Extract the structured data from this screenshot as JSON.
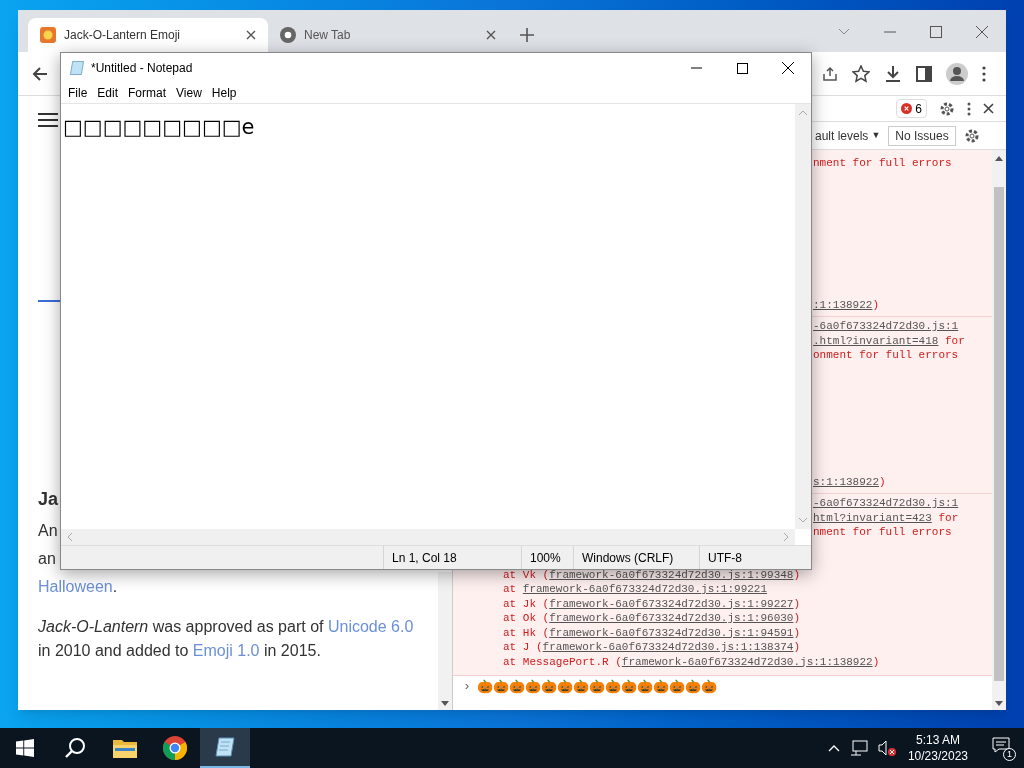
{
  "browser": {
    "tabs": [
      {
        "title": "Jack-O-Lantern Emoji",
        "selected": true
      },
      {
        "title": "New Tab",
        "selected": false
      }
    ],
    "page": {
      "heading": "Ja",
      "lines": [
        "An",
        "an"
      ],
      "link_line": {
        "link": "Halloween",
        "after": "."
      },
      "paragraph": [
        {
          "kind": "italic",
          "text": "Jack-O-Lantern"
        },
        {
          "kind": "plain",
          "text": " was approved as part of "
        },
        {
          "kind": "link",
          "text": "Unicode 6.0"
        },
        {
          "kind": "plain",
          "text": " in 2010 and added to "
        },
        {
          "kind": "link",
          "text": "Emoji 1.0"
        },
        {
          "kind": "plain",
          "text": " in 2015."
        }
      ]
    },
    "devtools": {
      "error_count": "6",
      "levels": "ault levels",
      "levels_caret": "▼",
      "issues": "No Issues",
      "messages": [
        {
          "top": [
            {
              "kind": "text",
              "text": "nment for full errors"
            }
          ],
          "bottom": [
            {
              "kind": "link",
              "text": ":1:138922"
            },
            {
              "kind": "text",
              "text": ")"
            }
          ]
        },
        {
          "top": [
            {
              "kind": "link",
              "text": "-6a0f673324d72d30.js:1"
            },
            {
              "kind": "link",
              "text": ".html?invariant=418",
              "after": " for"
            },
            {
              "kind": "text",
              "text": "onment for full errors"
            }
          ],
          "bottom": [
            {
              "kind": "link",
              "text": "s:1:138922"
            },
            {
              "kind": "text",
              "text": ")"
            }
          ]
        },
        {
          "top": [
            {
              "kind": "link",
              "text": "-6a0f673324d72d30.js:1"
            },
            {
              "kind": "link",
              "text": "html?invariant=423",
              "after": " for"
            },
            {
              "kind": "text",
              "text": "nment for full errors"
            }
          ],
          "stack": [
            {
              "prefix": "at Vk (",
              "src": "framework-6a0f673324d72d30.js:1:99348",
              "suffix": ")"
            },
            {
              "prefix": "at ",
              "src": "framework-6a0f673324d72d30.js:1:99221"
            },
            {
              "prefix": "at Jk (",
              "src": "framework-6a0f673324d72d30.js:1:99227",
              "suffix": ")"
            },
            {
              "prefix": "at Ok (",
              "src": "framework-6a0f673324d72d30.js:1:96030",
              "suffix": ")"
            },
            {
              "prefix": "at Hk (",
              "src": "framework-6a0f673324d72d30.js:1:94591",
              "suffix": ")"
            },
            {
              "prefix": "at J (",
              "src": "framework-6a0f673324d72d30.js:1:138374",
              "suffix": ")"
            },
            {
              "prefix": "at MessagePort.R (",
              "src": "framework-6a0f673324d72d30.js:1:138922",
              "suffix": ")"
            }
          ]
        }
      ],
      "prompt": "›",
      "input": "🎃🎃🎃🎃🎃🎃🎃🎃🎃🎃🎃🎃🎃🎃🎃"
    }
  },
  "notepad": {
    "title": "*Untitled - Notepad",
    "menu": [
      "File",
      "Edit",
      "Format",
      "View",
      "Help"
    ],
    "text": "□□□□□□□□□e",
    "status": [
      "Ln 1, Col 18",
      "100%",
      "Windows (CRLF)",
      "UTF-8"
    ]
  },
  "taskbar": {
    "apps": [
      {
        "kind": "start",
        "active": false
      },
      {
        "kind": "search",
        "active": false
      },
      {
        "kind": "explorer",
        "active": false
      },
      {
        "kind": "chrome",
        "active": false
      },
      {
        "kind": "notepad",
        "active": true
      }
    ],
    "time": "5:13 AM",
    "date": "10/23/2023",
    "notifications": "1"
  }
}
